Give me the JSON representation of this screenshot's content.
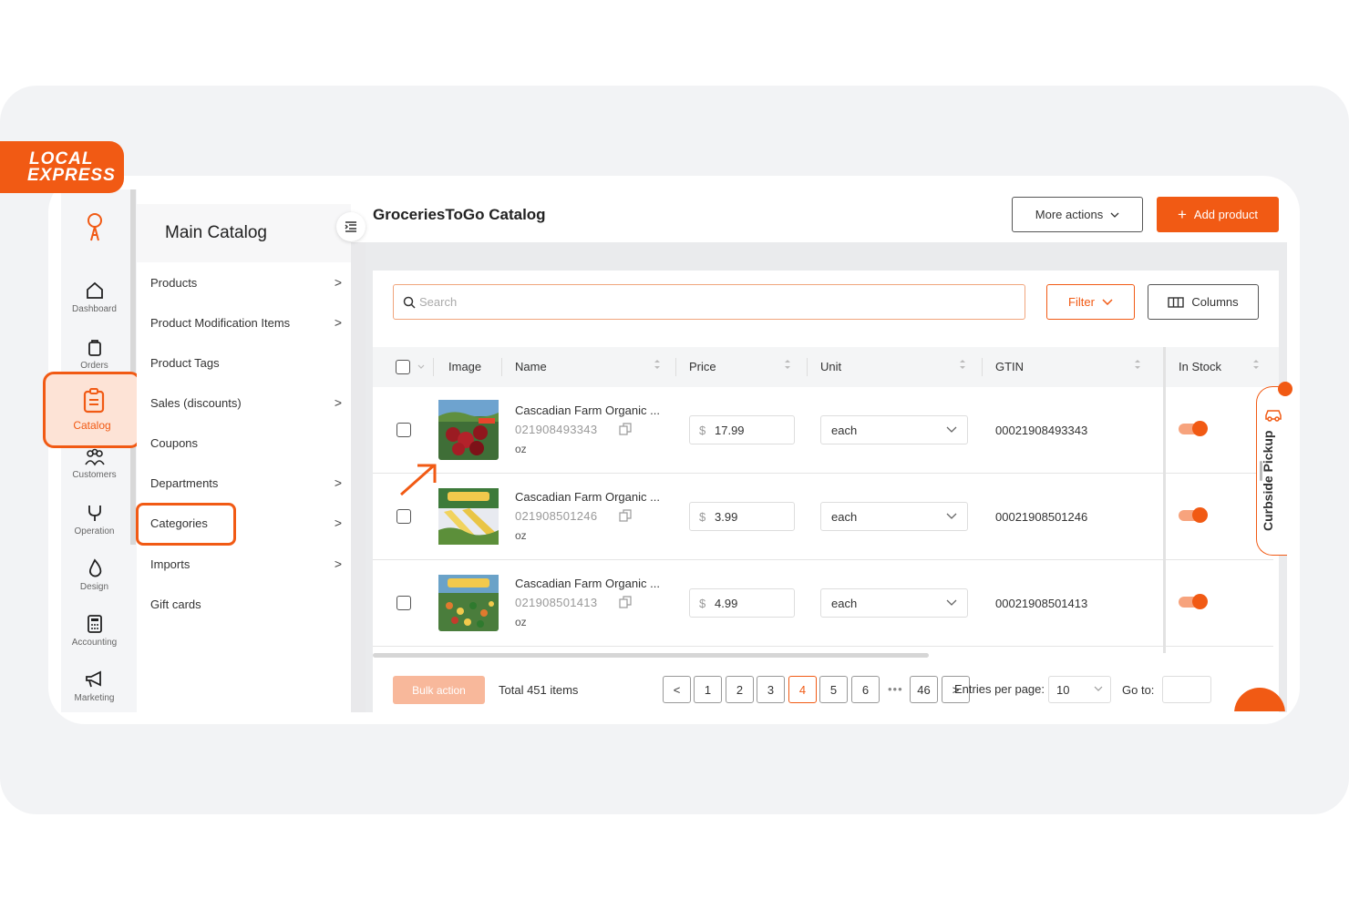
{
  "brand": {
    "line1": "LOCAL",
    "line2": "EXPRESS",
    "accent": "#f15a14"
  },
  "rail": [
    {
      "label": "Dashboard",
      "icon": "home-icon"
    },
    {
      "label": "Orders",
      "icon": "bag-icon"
    },
    {
      "label": "Catalog",
      "icon": "clipboard-icon",
      "active": true
    },
    {
      "label": "Customers",
      "icon": "people-icon"
    },
    {
      "label": "Operation",
      "icon": "stethoscope-icon"
    },
    {
      "label": "Design",
      "icon": "drops-icon"
    },
    {
      "label": "Accounting",
      "icon": "calculator-icon"
    },
    {
      "label": "Marketing",
      "icon": "megaphone-icon"
    }
  ],
  "submenu": {
    "title": "Main Catalog",
    "items": [
      {
        "label": "Products",
        "has_children": true
      },
      {
        "label": "Product Modification Items",
        "has_children": true
      },
      {
        "label": "Product Tags",
        "has_children": false
      },
      {
        "label": "Sales (discounts)",
        "has_children": true
      },
      {
        "label": "Coupons",
        "has_children": false
      },
      {
        "label": "Departments",
        "has_children": true
      },
      {
        "label": "Categories",
        "has_children": true,
        "highlighted": true
      },
      {
        "label": "Imports",
        "has_children": true
      },
      {
        "label": "Gift cards",
        "has_children": false
      }
    ]
  },
  "header": {
    "title": "GroceriesToGo Catalog",
    "more_actions": "More actions",
    "add_product": "Add product"
  },
  "toolbar": {
    "search_placeholder": "Search",
    "filter": "Filter",
    "columns": "Columns"
  },
  "table": {
    "columns": [
      "Image",
      "Name",
      "Price",
      "Unit",
      "GTIN",
      "In Stock"
    ],
    "rows": [
      {
        "name": "Cascadian Farm Organic ...",
        "code": "021908493343",
        "size_unit": "oz",
        "currency": "$",
        "price": "17.99",
        "unit": "each",
        "gtin": "00021908493343",
        "in_stock": true,
        "thumb": "cherries"
      },
      {
        "name": "Cascadian Farm Organic ...",
        "code": "021908501246",
        "size_unit": "oz",
        "currency": "$",
        "price": "3.99",
        "unit": "each",
        "gtin": "00021908501246",
        "in_stock": true,
        "thumb": "corn"
      },
      {
        "name": "Cascadian Farm Organic ...",
        "code": "021908501413",
        "size_unit": "oz",
        "currency": "$",
        "price": "4.99",
        "unit": "each",
        "gtin": "00021908501413",
        "in_stock": true,
        "thumb": "vegetables"
      }
    ]
  },
  "footer": {
    "bulk_action": "Bulk action",
    "total": "Total 451 items",
    "pages": [
      "1",
      "2",
      "3",
      "4",
      "5",
      "6"
    ],
    "current_page": "4",
    "ellipsis": "•••",
    "last_page": "46",
    "prev": "<",
    "next": ">",
    "entries_label": "Entries per page:",
    "entries_value": "10",
    "goto_label": "Go to:"
  },
  "curbside": {
    "label": "Curbside Pickup"
  }
}
